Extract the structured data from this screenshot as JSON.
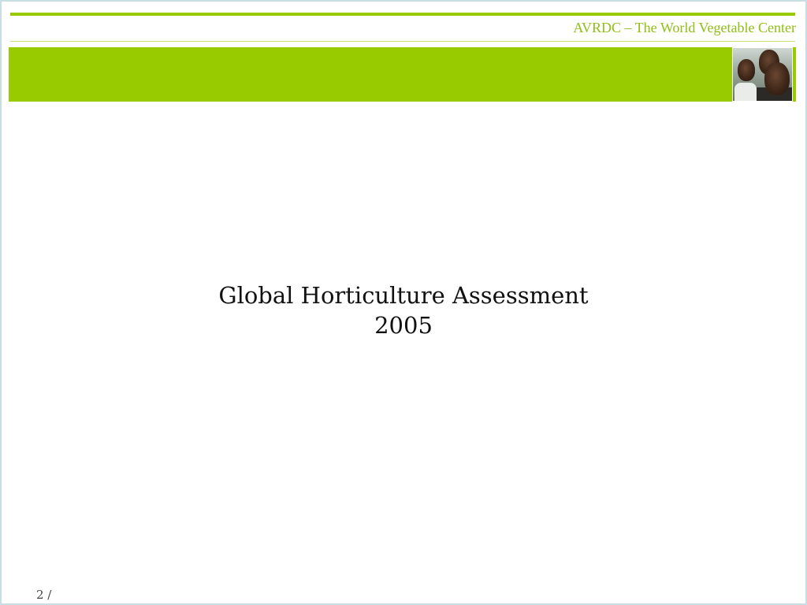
{
  "header": {
    "organization": "AVRDC – The World Vegetable Center",
    "accent_color": "#99cc00",
    "text_accent_color": "#8fbf14"
  },
  "slide": {
    "title_line1": "Global Horticulture Assessment",
    "title_line2": "2005",
    "page_label": "2 /"
  }
}
